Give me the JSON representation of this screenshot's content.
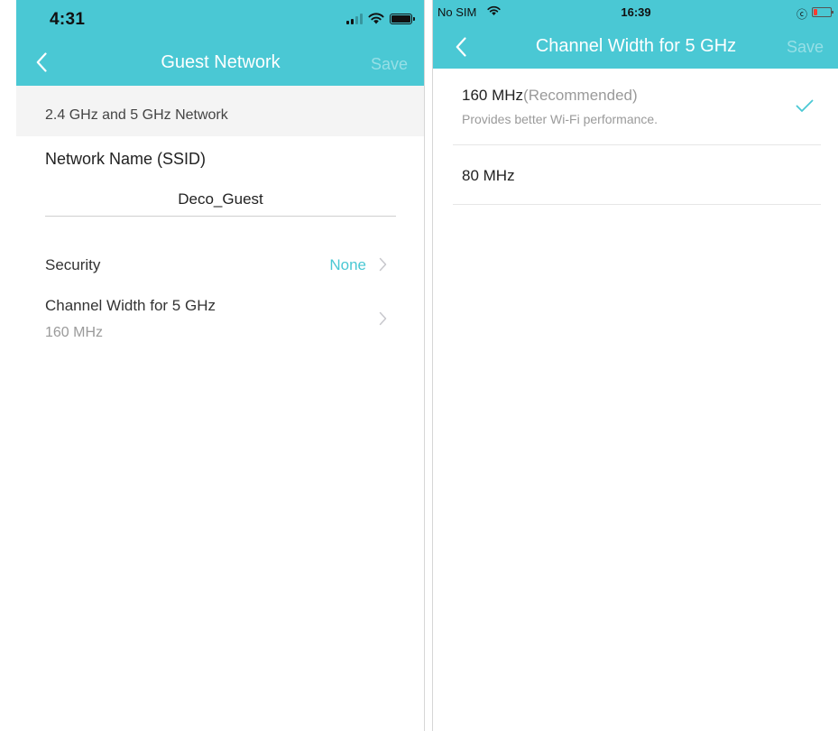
{
  "left": {
    "status_bar": {
      "time": "4:31"
    },
    "nav": {
      "title": "Guest Network",
      "save_label": "Save"
    },
    "section_header": "2.4 GHz and 5 GHz Network",
    "ssid": {
      "label": "Network Name (SSID)",
      "value": "Deco_Guest"
    },
    "security": {
      "label": "Security",
      "value": "None"
    },
    "channel_width": {
      "label": "Channel Width for 5 GHz",
      "value": "160 MHz"
    }
  },
  "right": {
    "status_bar": {
      "carrier": "No SIM",
      "time": "16:39",
      "orientation_lock_icon": "ⓒ"
    },
    "nav": {
      "title": "Channel Width for 5 GHz",
      "save_label": "Save"
    },
    "options": [
      {
        "label": "160 MHz",
        "tag": "(Recommended)",
        "description": "Provides better Wi-Fi performance.",
        "selected": true
      },
      {
        "label": "80 MHz",
        "selected": false
      }
    ]
  },
  "colors": {
    "accent": "#4ac8d4",
    "muted": "#9a9a9a",
    "section_bg": "#f4f4f4"
  },
  "icons": [
    "signal-icon",
    "wifi-icon",
    "battery-icon",
    "back-chevron-icon",
    "chevron-right-icon",
    "checkmark-icon",
    "orientation-lock-icon"
  ]
}
